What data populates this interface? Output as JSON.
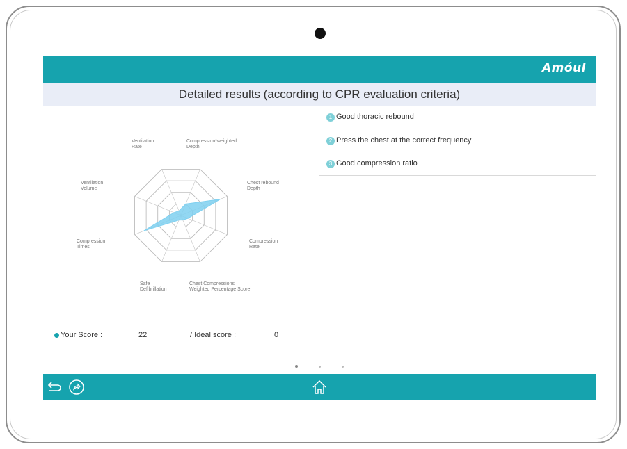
{
  "brand": "Amóul",
  "title": "Detailed results (according to CPR evaluation criteria)",
  "radar": {
    "axes": [
      "Compression*weighted\nDepth",
      "Chest rebound\nDepth",
      "Compression\nRate",
      "Chest Compressions\nWeighted Percentage Score",
      "Safe\nDefibrillation",
      "Compression\nTimes",
      "Ventilation\nVolume",
      "Ventilation\nRate"
    ],
    "levels": 4,
    "values": [
      0.25,
      0.85,
      0.15,
      0.1,
      0.1,
      0.8,
      0.15,
      0.1
    ]
  },
  "score": {
    "your_label": "Your Score :",
    "your_value": "22",
    "ideal_label": "/ Ideal score :",
    "ideal_value": "0"
  },
  "criteria": [
    {
      "num": "1",
      "text": "Good thoracic rebound"
    },
    {
      "num": "2",
      "text": "Press the chest at the correct frequency"
    },
    {
      "num": "3",
      "text": "Good compression ratio"
    }
  ],
  "pager": {
    "pages": 3,
    "active": 0
  },
  "colors": {
    "accent": "#16a3ae",
    "title_band": "#e9edf7",
    "radar_fill": "#7fd0f0"
  },
  "icons": {
    "back": "back-arrow-icon",
    "share": "share-icon",
    "home": "home-icon"
  }
}
